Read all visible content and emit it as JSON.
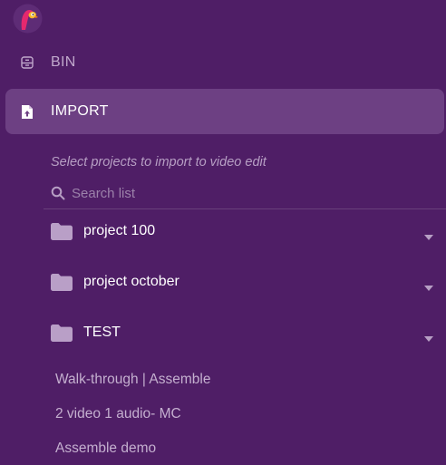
{
  "app": {
    "logo_icon": "parrot-logo-icon"
  },
  "nav": {
    "items": [
      {
        "label": "BIN",
        "icon": "archive-box-icon",
        "active": false
      },
      {
        "label": "IMPORT",
        "icon": "file-import-icon",
        "active": true
      }
    ]
  },
  "import": {
    "subtitle": "Select projects to import to video edit",
    "search": {
      "placeholder": "Search list",
      "value": ""
    },
    "folders": [
      {
        "label": "project 100",
        "icon": "folder-icon",
        "expanded": false
      },
      {
        "label": "project october",
        "icon": "folder-icon",
        "expanded": false
      },
      {
        "label": "TEST",
        "icon": "folder-icon",
        "expanded": true
      }
    ],
    "projects": [
      {
        "label": "Walk-through | Assemble"
      },
      {
        "label": "2 video 1 audio- MC"
      },
      {
        "label": "Assemble demo"
      }
    ]
  },
  "colors": {
    "background": "#4f1e66",
    "active_item": "#6d4083",
    "muted_text": "#c4afcf",
    "accent_pink": "#e5286e"
  }
}
